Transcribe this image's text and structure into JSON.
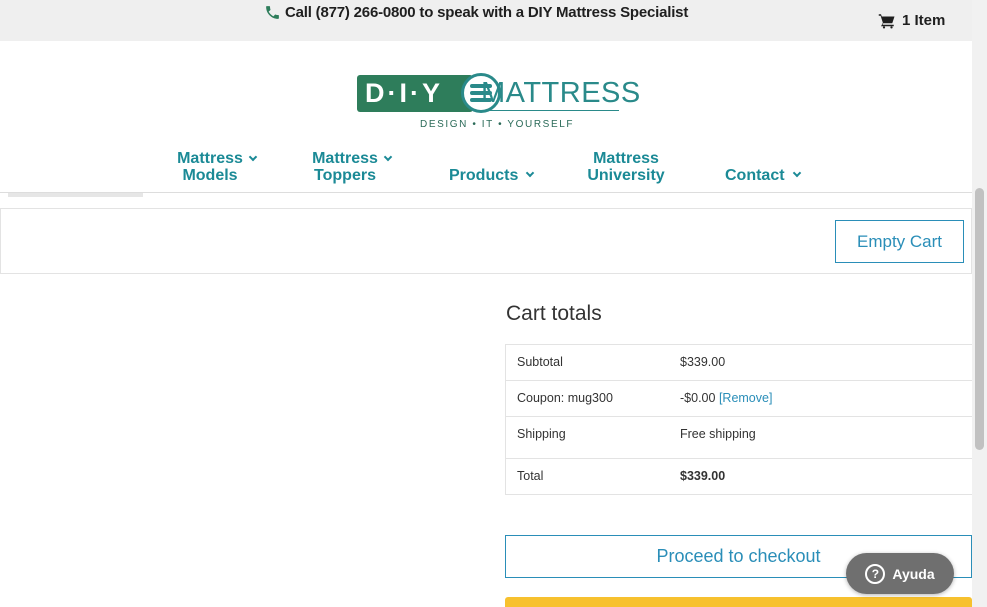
{
  "topbar": {
    "phone_text": "Call (877) 266-0800 to speak with a DIY Mattress Specialist",
    "cart_label": "1 Item"
  },
  "logo": {
    "brand_left": "D·I·Y",
    "brand_right": "MATTRESS",
    "tagline": "DESIGN • IT • YOURSELF"
  },
  "nav": {
    "items": [
      {
        "label1": "Mattress",
        "label2": "Models"
      },
      {
        "label1": "Mattress",
        "label2": "Toppers"
      },
      {
        "label1": "Products"
      },
      {
        "label1": "Mattress",
        "label2": "University"
      },
      {
        "label1": "Contact"
      }
    ]
  },
  "cart": {
    "empty_label": "Empty Cart"
  },
  "totals": {
    "title": "Cart totals",
    "rows": [
      {
        "label": "Subtotal",
        "value": "$339.00"
      },
      {
        "label": "Coupon: mug300",
        "value": "-$0.00",
        "link": "[Remove]"
      },
      {
        "label": "Shipping",
        "value": "Free shipping"
      },
      {
        "label": "Total",
        "value": "$339.00"
      }
    ],
    "checkout_label": "Proceed to checkout"
  },
  "help": {
    "label": "Ayuda",
    "icon_glyph": "?"
  },
  "colors": {
    "brand_green": "#2e7d5b",
    "brand_teal": "#2a8a8a",
    "nav_teal": "#1b8a96",
    "link_blue": "#2a8eb8",
    "cta_yellow": "#f7c12e"
  }
}
